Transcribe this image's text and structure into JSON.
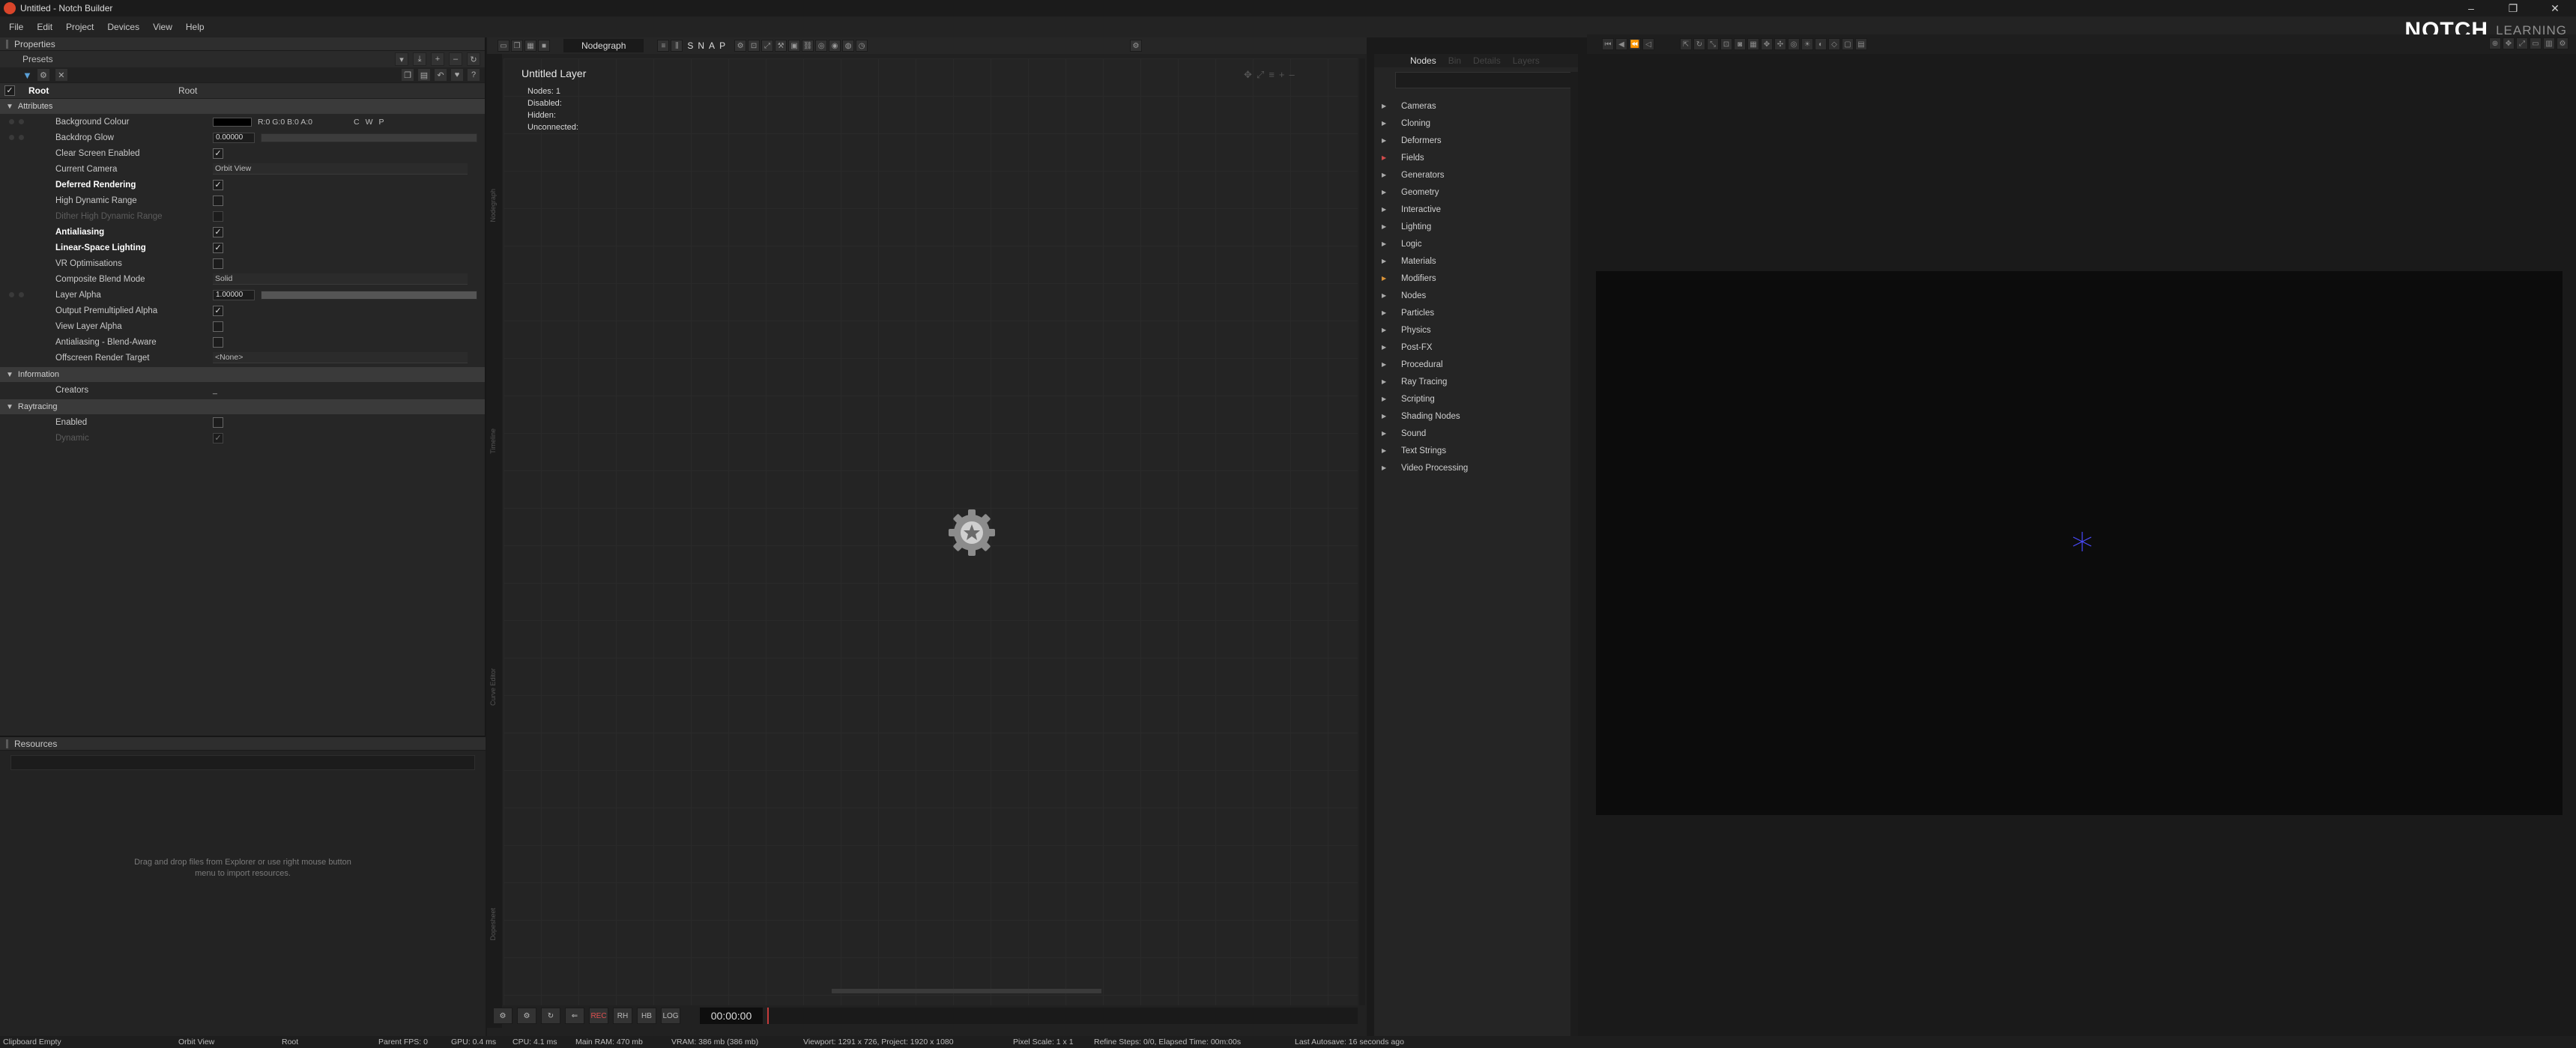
{
  "window": {
    "title": "Untitled - Notch Builder"
  },
  "menu": [
    "File",
    "Edit",
    "Project",
    "Devices",
    "View",
    "Help"
  ],
  "brand": {
    "logo": "NOTCH",
    "sub": "LEARNING"
  },
  "properties": {
    "title": "Properties",
    "presets_label": "Presets",
    "node": {
      "name": "Root",
      "type": "Root"
    },
    "sections": {
      "attributes": "Attributes",
      "information": "Information",
      "raytracing": "Raytracing"
    },
    "rows": {
      "background_colour": {
        "label": "Background Colour",
        "value": "R:0 G:0 B:0 A:0",
        "c": "C",
        "w": "W",
        "p": "P"
      },
      "backdrop_glow": {
        "label": "Backdrop Glow",
        "value": "0.00000"
      },
      "clear_screen": {
        "label": "Clear Screen Enabled"
      },
      "current_camera": {
        "label": "Current Camera",
        "value": "Orbit View"
      },
      "deferred": {
        "label": "Deferred Rendering"
      },
      "hdr": {
        "label": "High Dynamic Range"
      },
      "dither_hdr": {
        "label": "Dither High Dynamic Range"
      },
      "antialiasing": {
        "label": "Antialiasing"
      },
      "linear_lighting": {
        "label": "Linear-Space Lighting"
      },
      "vr_opt": {
        "label": "VR Optimisations"
      },
      "composite_blend": {
        "label": "Composite Blend Mode",
        "value": "Solid"
      },
      "layer_alpha": {
        "label": "Layer Alpha",
        "value": "1.00000"
      },
      "premult": {
        "label": "Output Premultiplied Alpha"
      },
      "view_layer_alpha": {
        "label": "View Layer Alpha"
      },
      "aa_blend": {
        "label": "Antialiasing - Blend-Aware"
      },
      "offscreen": {
        "label": "Offscreen Render Target",
        "value": "<None>"
      },
      "creators": {
        "label": "Creators",
        "value": "_"
      },
      "rt_enabled": {
        "label": "Enabled"
      },
      "rt_dynamic": {
        "label": "Dynamic"
      }
    }
  },
  "resources": {
    "title": "Resources",
    "hint_line1": "Drag and drop files from Explorer or use right mouse button",
    "hint_line2": "menu to import resources."
  },
  "nodegraph": {
    "tab": "Nodegraph",
    "snap": "SNAP",
    "layer_title": "Untitled  Layer",
    "stats": {
      "nodes": "Nodes:  1",
      "disabled": "Disabled:",
      "hidden": "Hidden:",
      "unconnected": "Unconnected:"
    },
    "side_labels": [
      "Nodegraph",
      "Timeline",
      "Curve Editor",
      "Dopesheet"
    ],
    "transport": {
      "rec": "REC",
      "time": "00:00:00",
      "b1": "RH",
      "b2": "HB",
      "b3": "LOG"
    }
  },
  "nodes_panel": {
    "tabs": [
      "Nodes",
      "Bin",
      "Details",
      "Layers"
    ],
    "categories": [
      {
        "label": "Cameras",
        "color": "default"
      },
      {
        "label": "Cloning",
        "color": "default"
      },
      {
        "label": "Deformers",
        "color": "default"
      },
      {
        "label": "Fields",
        "color": "red"
      },
      {
        "label": "Generators",
        "color": "default"
      },
      {
        "label": "Geometry",
        "color": "default"
      },
      {
        "label": "Interactive",
        "color": "default"
      },
      {
        "label": "Lighting",
        "color": "default"
      },
      {
        "label": "Logic",
        "color": "default"
      },
      {
        "label": "Materials",
        "color": "default"
      },
      {
        "label": "Modifiers",
        "color": "orange"
      },
      {
        "label": "Nodes",
        "color": "default"
      },
      {
        "label": "Particles",
        "color": "default"
      },
      {
        "label": "Physics",
        "color": "default"
      },
      {
        "label": "Post-FX",
        "color": "default"
      },
      {
        "label": "Procedural",
        "color": "default"
      },
      {
        "label": "Ray Tracing",
        "color": "default"
      },
      {
        "label": "Scripting",
        "color": "default"
      },
      {
        "label": "Shading Nodes",
        "color": "default"
      },
      {
        "label": "Sound",
        "color": "default"
      },
      {
        "label": "Text Strings",
        "color": "default"
      },
      {
        "label": "Video Processing",
        "color": "default"
      }
    ]
  },
  "status": {
    "clipboard": "Clipboard Empty",
    "camera": "Orbit View",
    "node": "Root",
    "fps": "Parent  FPS: 0",
    "gpu": "GPU: 0.4 ms",
    "cpu": "CPU: 4.1 ms",
    "ram": "Main RAM: 470 mb",
    "vram": "VRAM: 386 mb (386 mb)",
    "viewport": "Viewport: 1291 x 726, Project: 1920 x 1080",
    "pixel_scale": "Pixel Scale: 1 x 1",
    "refine": "Refine Steps: 0/0, Elapsed Time: 00m:00s",
    "autosave": "Last Autosave: 16 seconds ago"
  },
  "colors": {
    "accent_red": "#d9452a",
    "bg": "#1a1a1a",
    "panel": "#262626",
    "viewport": "#0c0c0c"
  }
}
